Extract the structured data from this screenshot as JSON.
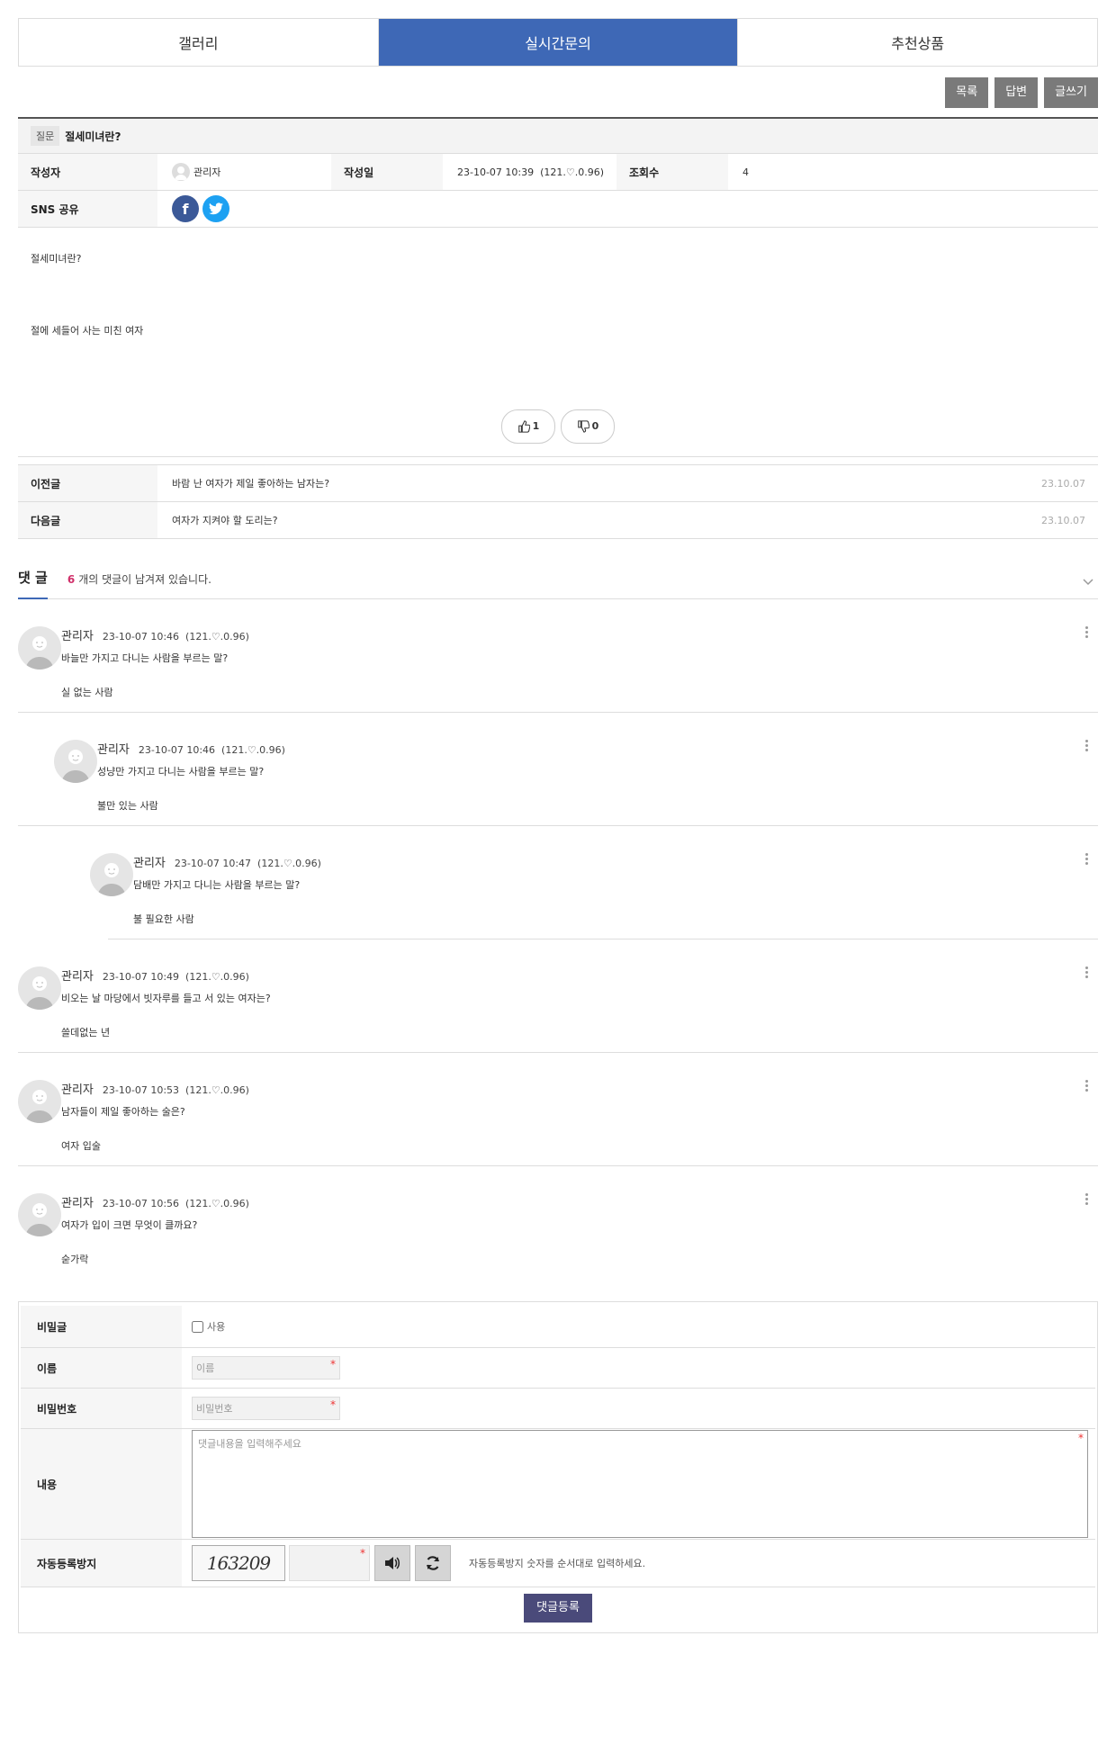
{
  "tabs": [
    {
      "label": "갤러리",
      "active": false
    },
    {
      "label": "실시간문의",
      "active": true
    },
    {
      "label": "추천상품",
      "active": false
    }
  ],
  "top_buttons": {
    "list": "목록",
    "reply": "답변",
    "write": "글쓰기"
  },
  "post": {
    "badge": "질문",
    "title": "절세미녀란?",
    "author_label": "작성자",
    "author": "관리자",
    "date_label": "작성일",
    "date": "23-10-07 10:39",
    "ip": "(121.♡.0.96)",
    "views_label": "조회수",
    "views": "4",
    "sns_label": "SNS 공유",
    "body_line1": "절세미녀란?",
    "body_line2": "절에 세들어 사는 미친 여자",
    "likes": "1",
    "dislikes": "0"
  },
  "nav": {
    "prev_label": "이전글",
    "prev_title": "바람 난 여자가 제일 좋아하는 남자는?",
    "prev_date": "23.10.07",
    "next_label": "다음글",
    "next_title": "여자가 지켜야 할 도리는?",
    "next_date": "23.10.07"
  },
  "comments_header": {
    "label": "댓 글",
    "count": "6",
    "text": "개의 댓글이 남겨져 있습니다."
  },
  "comments": [
    {
      "name": "관리자",
      "date": "23-10-07 10:46",
      "ip": "(121.♡.0.96)",
      "question": "바늘만 가지고 다니는 사람을 부르는 말?",
      "answer": "실 없는 사람",
      "depth": 0
    },
    {
      "name": "관리자",
      "date": "23-10-07 10:46",
      "ip": "(121.♡.0.96)",
      "question": "성냥만 가지고 다니는 사람을 부르는 말?",
      "answer": "불만 있는 사람",
      "depth": 1
    },
    {
      "name": "관리자",
      "date": "23-10-07 10:47",
      "ip": "(121.♡.0.96)",
      "question": "담배만 가지고 다니는 사람을 부르는 말?",
      "answer": "불 필요한 사람",
      "depth": 2
    },
    {
      "name": "관리자",
      "date": "23-10-07 10:49",
      "ip": "(121.♡.0.96)",
      "question": "비오는 날 마당에서 빗자루를 들고 서 있는 여자는?",
      "answer": "쓸데없는 년",
      "depth": 0
    },
    {
      "name": "관리자",
      "date": "23-10-07 10:53",
      "ip": "(121.♡.0.96)",
      "question": "남자들이 제일 좋아하는 술은?",
      "answer": "여자 입술",
      "depth": 0
    },
    {
      "name": "관리자",
      "date": "23-10-07 10:56",
      "ip": "(121.♡.0.96)",
      "question": "여자가 입이 크면 무엇이 클까요?",
      "answer": "숟가락",
      "depth": 0
    }
  ],
  "form": {
    "secret_label": "비밀글",
    "secret_option": "사용",
    "name_label": "이름",
    "name_placeholder": "이름",
    "password_label": "비밀번호",
    "password_placeholder": "비밀번호",
    "content_label": "내용",
    "content_placeholder": "댓글내용을 입력해주세요",
    "captcha_label": "자동등록방지",
    "captcha_text": "163209",
    "captcha_hint": "자동등록방지 숫자를 순서대로 입력하세요.",
    "submit_label": "댓글등록"
  },
  "colors": {
    "accent": "#3e68b6",
    "button_gray": "#7a7a7a",
    "submit": "#4a4a7a",
    "count": "#d0306a"
  }
}
